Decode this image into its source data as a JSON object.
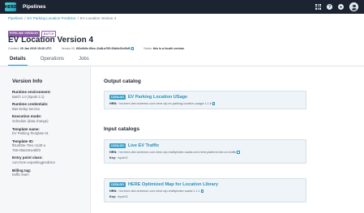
{
  "app": {
    "logo_text": "HERE",
    "title": "Pipelines"
  },
  "breadcrumb": {
    "root": "Pipelines",
    "sep1": "/",
    "pipeline": "EV Parking Location Predictor",
    "sep2": "/",
    "current": "EV Location Version 4"
  },
  "header": {
    "badge_version": "PIPELINE VERSION",
    "badge_mode": "BATCH",
    "title": "EV Location Version 4",
    "created_label": "Created:",
    "created_value": "29 Jan 2019 15:26 UTC",
    "version_id_label": "Version ID:",
    "version_id_value": "f81efb0e-90ec-11d8-a765-00a0c91e6bf3",
    "notes_label": "Notes:",
    "notes_value": "this is a fourth version"
  },
  "tabs": [
    {
      "label": "Details",
      "active": true
    },
    {
      "label": "Operations",
      "active": false
    },
    {
      "label": "Jobs",
      "active": false
    }
  ],
  "version_info": {
    "title": "Version Info",
    "fields": [
      {
        "label": "Runtime environment:",
        "value": "Batch 1.0 (Spark 2.1)"
      },
      {
        "label": "Runtime credentials:",
        "value": "Bas Delay Service"
      },
      {
        "label": "Execution mode:",
        "value": "Schedule (data change)"
      },
      {
        "label": "Template name:",
        "value": "EV Parking Template 01"
      },
      {
        "label": "Template ID:",
        "value": "f81efb0e-70ec-11d0-a765-00a0c91e6bf3"
      },
      {
        "label": "Entry point class:",
        "value": "com.here.evparkingpredictor"
      },
      {
        "label": "Billing tag:",
        "value": "traffic team"
      }
    ]
  },
  "output_catalog": {
    "title": "Output catalog",
    "items": [
      {
        "badge": "CATALOG",
        "name": "EV Parking Location USage",
        "hrn_label": "HRN:",
        "hrn": "hrn:here-dev:schema::com.here.olp.ev-parking-location-usage:1.1.6"
      }
    ]
  },
  "input_catalogs": {
    "title": "Input catalogs",
    "items": [
      {
        "badge": "CATALOG",
        "name": "Live EV Traffic",
        "hrn_label": "HRN:",
        "hrn": "hrn:here-dev:schema::com.here.olp.realityindex.roads:com.here.platform.live-ev-traffic",
        "key_label": "Key:",
        "key": "input01"
      },
      {
        "badge": "CATALOG",
        "name": "HERE Optimized Map for Location Library",
        "hrn_label": "HRN:",
        "hrn": "hrn:here-dev:schema::com.here.olp.realityindex.roads:1.1.1",
        "key_label": "Key:",
        "key": "input02"
      }
    ]
  },
  "colors": {
    "topbar": "#1b2430",
    "accent": "#2b8fb8",
    "pipeline_badge": "#8a5aa5",
    "catalog_badge": "#3ba0c9"
  }
}
